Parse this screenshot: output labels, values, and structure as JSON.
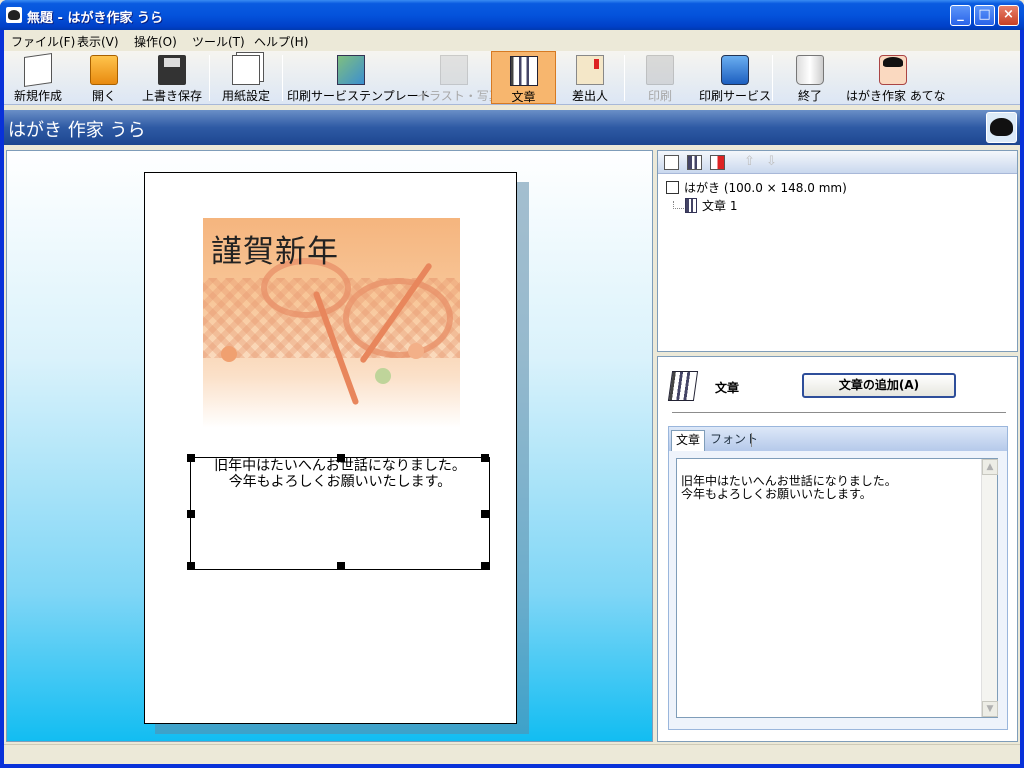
{
  "window": {
    "title": "無題 - はがき作家 うら",
    "controls": {
      "minimize": "_",
      "maximize": "□",
      "close": "×"
    }
  },
  "menu": [
    {
      "label": "ファイル(F)"
    },
    {
      "label": "表示(V)"
    },
    {
      "label": "操作(O)"
    },
    {
      "label": "ツール(T)"
    },
    {
      "label": "ヘルプ(H)"
    }
  ],
  "toolbar": [
    {
      "label": "新規作成",
      "icon": "new-page-icon",
      "state": "enabled"
    },
    {
      "label": "開く",
      "icon": "folder-icon",
      "state": "enabled"
    },
    {
      "label": "上書き保存",
      "icon": "floppy-icon",
      "state": "enabled"
    },
    {
      "label": "用紙設定",
      "icon": "paper-setup-icon",
      "state": "enabled"
    },
    {
      "label": "印刷サービステンプレート",
      "icon": "template-icon",
      "state": "enabled"
    },
    {
      "label": "イラスト・写真",
      "icon": "illustration-icon",
      "state": "disabled"
    },
    {
      "label": "文章",
      "icon": "text-book-icon",
      "state": "active"
    },
    {
      "label": "差出人",
      "icon": "sender-icon",
      "state": "enabled"
    },
    {
      "label": "印刷",
      "icon": "printer-icon",
      "state": "disabled"
    },
    {
      "label": "印刷サービス",
      "icon": "print-service-icon",
      "state": "enabled"
    },
    {
      "label": "終了",
      "icon": "exit-jar-icon",
      "state": "enabled"
    },
    {
      "label": "はがき作家 あてな",
      "icon": "atena-app-icon",
      "state": "enabled"
    }
  ],
  "header": {
    "title": "はがき 作家 うら",
    "logo_icon": "hagaki-sakka-logo-icon"
  },
  "canvas": {
    "greeting_title": "謹賀新年",
    "textbox_text": "旧年中はたいへんお世話になりました。\n今年もよろしくお願いいたします。"
  },
  "tree": {
    "root_label": "はがき (100.0 × 148.0 mm)",
    "child_label": "文章 1"
  },
  "properties": {
    "title": "文章",
    "add_button": "文章の追加(A)",
    "tabs": [
      {
        "label": "文章"
      },
      {
        "label": "フォント"
      }
    ],
    "text_value": "旧年中はたいへんお世話になりました。\n今年もよろしくお願いいたします。"
  },
  "colors": {
    "active_tool": "#F7B66E",
    "header_band": "#2E5AA4",
    "canvas_gradient_bottom": "#12BDF2"
  }
}
